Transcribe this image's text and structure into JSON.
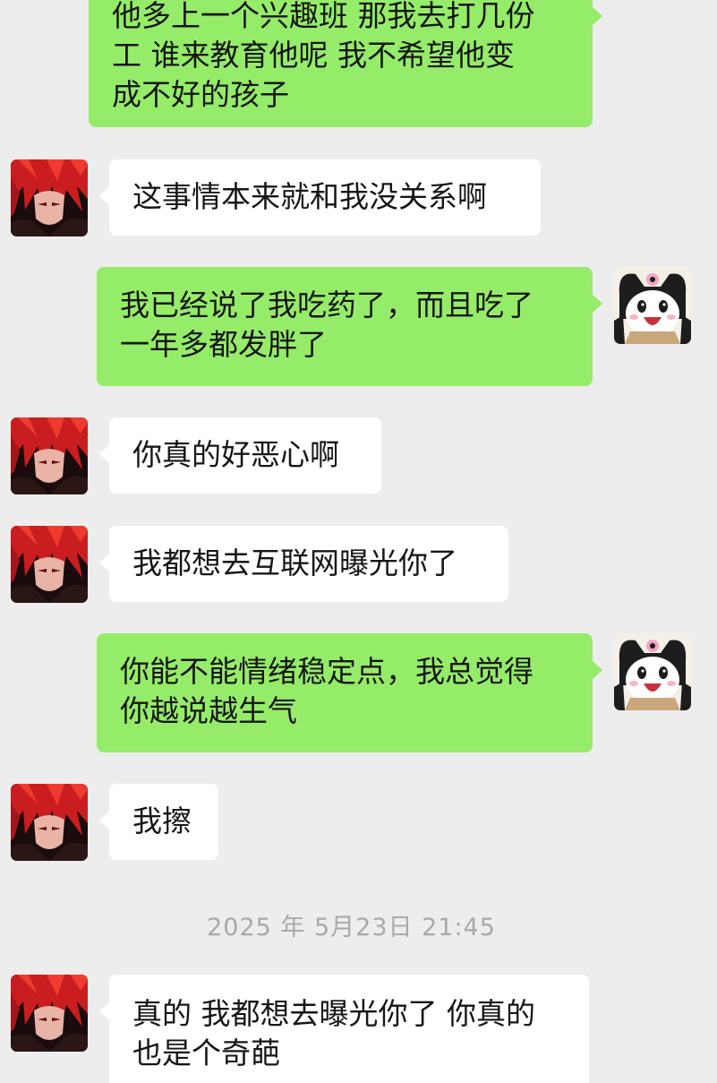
{
  "chat": {
    "messages": [
      {
        "sender": "self",
        "text": "他多上一个兴趣班 那我去打几份\n工 谁来教育他呢 我不希望他变\n成不好的孩子"
      },
      {
        "sender": "other",
        "text": "这事情本来就和我没关系啊"
      },
      {
        "sender": "self",
        "text": "我已经说了我吃药了，而且吃了\n一年多都发胖了"
      },
      {
        "sender": "other",
        "text": "你真的好恶心啊"
      },
      {
        "sender": "other",
        "text": "我都想去互联网曝光你了"
      },
      {
        "sender": "self",
        "text": "你能不能情绪稳定点，我总觉得\n你越说越生气"
      },
      {
        "sender": "other",
        "text": "我擦"
      },
      {
        "sender": "other",
        "text": "真的 我都想去曝光你了 你真的\n也是个奇葩"
      }
    ],
    "timestamp": "2025 年 5月23日 21:45"
  },
  "avatars": {
    "other": {
      "icon": "red-haired-anime-avatar-icon"
    },
    "self": {
      "icon": "kuromi-panda-avatar-icon"
    }
  },
  "colors": {
    "background": "#ededed",
    "self_bubble": "#95ec69",
    "other_bubble": "#ffffff",
    "timestamp_text": "#a9a9a9"
  }
}
